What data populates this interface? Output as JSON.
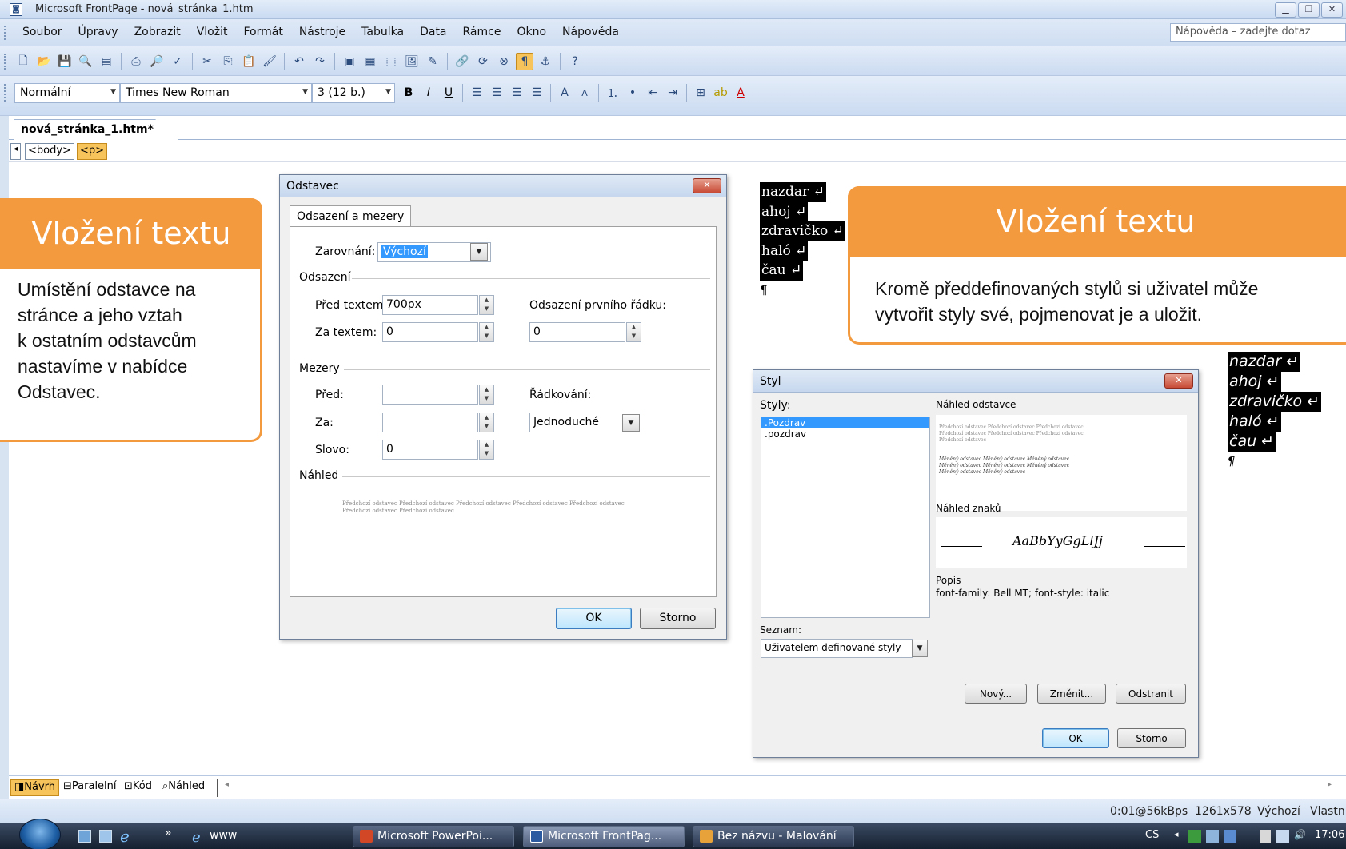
{
  "window": {
    "title": "Microsoft FrontPage - nová_stránka_1.htm",
    "app_icon": "frontpage-icon",
    "controls": [
      "minimize-icon",
      "restore-icon",
      "close-icon"
    ]
  },
  "menubar": {
    "items": [
      "Soubor",
      "Úpravy",
      "Zobrazit",
      "Vložit",
      "Formát",
      "Nástroje",
      "Tabulka",
      "Data",
      "Rámce",
      "Okno",
      "Nápověda"
    ],
    "help_placeholder": "Nápověda – zadejte dotaz"
  },
  "format_toolbar": {
    "style": "Normální",
    "font": "Times New Roman",
    "size": "3 (12 b.)"
  },
  "document": {
    "tab": "nová_stránka_1.htm*",
    "tags": [
      "<body>",
      "<p>"
    ]
  },
  "callout_left": {
    "title": "Vložení textu",
    "lines": [
      "Umístění odstavce na",
      "stránce a jeho vztah",
      "k ostatním odstavcům",
      "nastavíme v nabídce",
      "Odstavec."
    ]
  },
  "callout_right": {
    "title": "Vložení textu",
    "lines": [
      "Kromě předdefinovaných stylů si uživatel může",
      "vytvořit styly své, pojmenovat je a uložit."
    ]
  },
  "paragraph_dialog": {
    "title": "Odstavec",
    "tab": "Odsazení a mezery",
    "alignment_label": "Zarovnání:",
    "alignment_value": "Výchozí",
    "indent_group": "Odsazení",
    "before_text_label": "Před textem:",
    "before_text_value": "700px",
    "after_text_label": "Za textem:",
    "after_text_value": "0",
    "first_line_label": "Odsazení prvního řádku:",
    "first_line_value": "0",
    "spacing_group": "Mezery",
    "before_label": "Před:",
    "before_value": "",
    "after_label": "Za:",
    "after_value": "",
    "line_spacing_label": "Řádkování:",
    "line_spacing_value": "Jednoduché",
    "word_label": "Slovo:",
    "word_value": "0",
    "preview_group": "Náhled",
    "preview_line1": "Předchozí odstavec Předchozí odstavec Předchozí odstavec Předchozí odstavec Předchozí odstavec",
    "preview_line2": "Předchozí odstavec Předchozí odstavec",
    "ok": "OK",
    "cancel": "Storno"
  },
  "style_dialog": {
    "title": "Styl",
    "styles_label": "Styly:",
    "styles": [
      ".Pozdrav",
      ".pozdrav"
    ],
    "selected_index": 0,
    "para_preview_label": "Náhled odstavce",
    "para_preview_prev": [
      "Předchozí odstavec Předchozí odstavec Předchozí odstavec",
      "Předchozí odstavec Předchozí odstavec Předchozí odstavec",
      "Předchozí odstavec"
    ],
    "para_preview_cur": [
      "Měněný odstavec Měněný odstavec Měněný odstavec",
      "Měněný odstavec Měněný odstavec Měněný odstavec",
      "Měněný odstavec Měněný odstavec"
    ],
    "char_preview_label": "Náhled znaků",
    "char_preview_sample": "AaBbYyGgLlJj",
    "desc_label": "Popis",
    "desc_text": "font-family: Bell MT; font-style: italic",
    "list_label": "Seznam:",
    "list_value": "Uživatelem definované styly",
    "new_btn": "Nový...",
    "modify_btn": "Změnit...",
    "delete_btn": "Odstranit",
    "ok": "OK",
    "cancel": "Storno"
  },
  "text_block_1": [
    "nazdar ↵",
    "ahoj ↵",
    "zdravičko ↵",
    "haló ↵",
    "čau ↵"
  ],
  "text_block_2": [
    "nazdar ↵",
    "ahoj ↵",
    "zdravičko ↵",
    "haló ↵",
    "čau ↵"
  ],
  "pilcrow": "¶",
  "view_tabs": [
    "Návrh",
    "Paralelní",
    "Kód",
    "Náhled"
  ],
  "status": {
    "speed": "0:01@56kBps",
    "resolution": "1261x578",
    "default": "Výchozí",
    "custom": "Vlastn"
  },
  "taskbar": {
    "ie_label": "www",
    "buttons": [
      "Microsoft PowerPoi...",
      "Microsoft FrontPag...",
      "Bez názvu - Malování"
    ],
    "active_index": 1,
    "lang": "CS",
    "clock": "17:06"
  },
  "colors": {
    "callout_orange": "#f39a3f",
    "chrome_blue": "#cfdef2",
    "selection_blue": "#3399ff"
  }
}
